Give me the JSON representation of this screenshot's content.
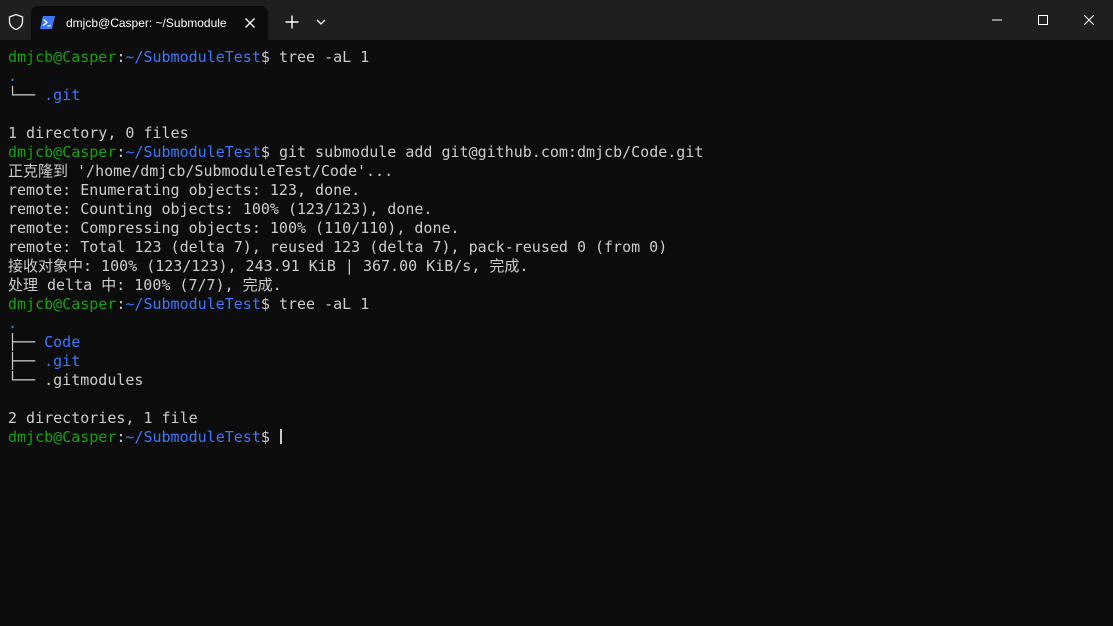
{
  "window": {
    "tab_title": "dmjcb@Casper: ~/Submodule"
  },
  "prompt": {
    "user_host": "dmjcb@Casper",
    "colon": ":",
    "path": "~/SubmoduleTest",
    "symbol": "$ "
  },
  "colors": {
    "background": "#0c0c0c",
    "titlebar": "#1f1f1f",
    "prompt_user": "#13a10e",
    "prompt_path": "#3b78ff",
    "text": "#cccccc"
  },
  "terminal": {
    "cmd1": "tree -aL 1",
    "tree1": {
      "root": ".",
      "branch": "└── ",
      "item": ".git"
    },
    "summary1": "1 directory, 0 files",
    "cmd2": "git submodule add git@github.com:dmjcb/Code.git",
    "output": [
      "正克隆到 '/home/dmjcb/SubmoduleTest/Code'...",
      "remote: Enumerating objects: 123, done.",
      "remote: Counting objects: 100% (123/123), done.",
      "remote: Compressing objects: 100% (110/110), done.",
      "remote: Total 123 (delta 7), reused 123 (delta 7), pack-reused 0 (from 0)",
      "接收对象中: 100% (123/123), 243.91 KiB | 367.00 KiB/s, 完成.",
      "处理 delta 中: 100% (7/7), 完成."
    ],
    "cmd3": "tree -aL 1",
    "tree2": {
      "root": ".",
      "branch_mid": "├── ",
      "branch_last": "└── ",
      "items": [
        "Code",
        ".git",
        ".gitmodules"
      ]
    },
    "summary2": "2 directories, 1 file"
  }
}
